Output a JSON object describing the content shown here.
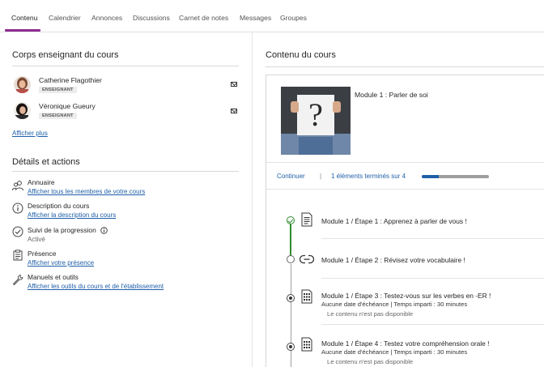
{
  "tabs": [
    {
      "label": "Contenu",
      "active": true
    },
    {
      "label": "Calendrier"
    },
    {
      "label": "Annonces"
    },
    {
      "label": "Discussions"
    },
    {
      "label": "Carnet de notes"
    },
    {
      "label": "Messages"
    },
    {
      "label": "Groupes"
    }
  ],
  "staff": {
    "title": "Corps enseignant du cours",
    "members": [
      {
        "name": "Catherine Flagothier",
        "role": "ENSEIGNANT",
        "icon": "mail-icon"
      },
      {
        "name": "Véronique Gueury",
        "role": "ENSEIGNANT",
        "icon": "mail-icon"
      }
    ],
    "show_more": "Afficher plus"
  },
  "details": {
    "title": "Détails et actions",
    "items": [
      {
        "title": "Annuaire",
        "link": "Afficher tous les membres de votre cours",
        "icon": "people-icon"
      },
      {
        "title": "Description du cours",
        "link": "Afficher la description du cours",
        "icon": "info-icon"
      },
      {
        "title": "Suivi de la progression",
        "sub": "Activé",
        "icon": "check-circle-icon"
      },
      {
        "title": "Présence",
        "link": "Afficher votre présence",
        "icon": "attendance-icon"
      },
      {
        "title": "Manuels et outils",
        "link": "Afficher les outils du cours et de l'établissement",
        "icon": "wrench-icon"
      }
    ]
  },
  "content": {
    "title": "Contenu du cours",
    "module": {
      "title": "Module 1 : Parler de soi",
      "continue_label": "Continuer",
      "separator": "|",
      "progress_text": "1 éléments terminés sur 4",
      "progress_fraction": 0.25
    },
    "steps": [
      {
        "title": "Module 1 / Étape 1 : Apprenez à parler de vous !",
        "status": "done",
        "icon": "document-icon"
      },
      {
        "title": "Module 1 / Étape 2 : Révisez votre vocabulaire !",
        "status": "open",
        "icon": "link-icon"
      },
      {
        "title": "Module 1 / Étape 3 : Testez-vous sur les verbes en -ER !",
        "status": "locked",
        "icon": "test-icon",
        "meta": "Aucune date d'échéance  | Temps imparti : 30 minutes",
        "note": "Le contenu n'est pas disponible"
      },
      {
        "title": "Module 1 / Étape 4 : Testez votre compréhension orale !",
        "status": "locked",
        "icon": "test-icon",
        "meta": "Aucune date d'échéance  | Temps imparti : 30 minutes",
        "note": "Le contenu n'est pas disponible"
      }
    ]
  },
  "colors": {
    "accent": "#8e2b91",
    "link": "#1f5fa8",
    "done": "#2f8a2f"
  }
}
